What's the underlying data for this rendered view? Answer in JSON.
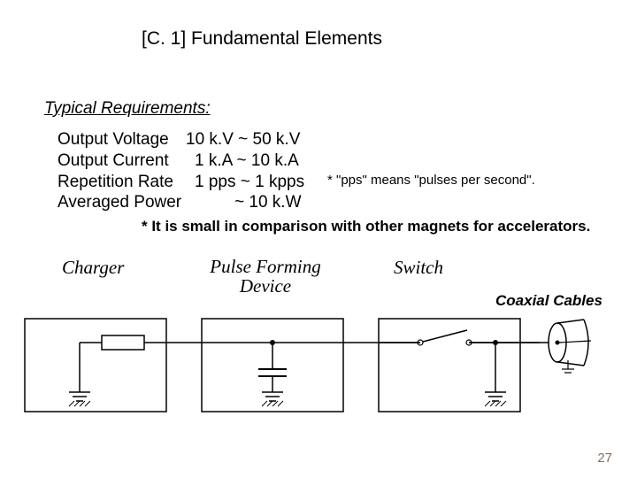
{
  "title": "[C. 1] Fundamental Elements",
  "subtitle": "Typical Requirements:",
  "specs": {
    "voltage_label": "Output Voltage",
    "voltage_value": "10 k.V ~ 50 k.V",
    "current_label": "Output Current",
    "current_value": "1 k.A ~ 10 k.A",
    "rate_label": "Repetition Rate",
    "rate_value": "1 pps ~ 1 kpps",
    "power_label": "Averaged Power",
    "power_value": "~ 10 k.W"
  },
  "note_pps": "* \"pps\" means \"pulses per second\".",
  "note_small": "* It is small in comparison with other magnets for accelerators.",
  "diagram": {
    "charger": "Charger",
    "pfd": "Pulse Forming Device",
    "switch": "Switch",
    "coax": "Coaxial Cables"
  },
  "page_number": "27"
}
